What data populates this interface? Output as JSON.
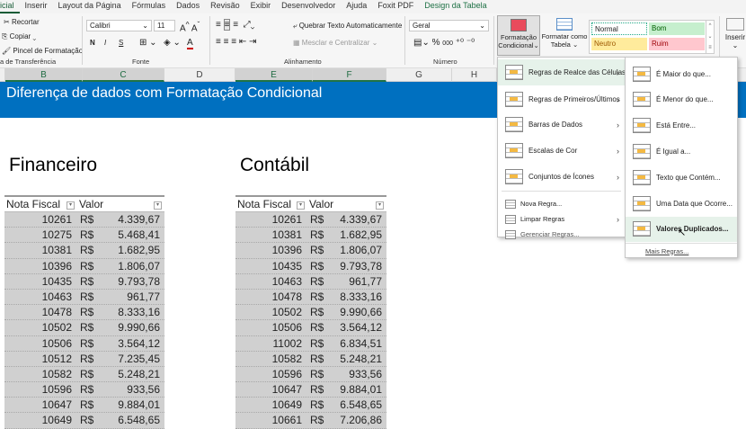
{
  "ribbon_tabs": [
    "icial",
    "Inserir",
    "Layout da Página",
    "Fórmulas",
    "Dados",
    "Revisão",
    "Exibir",
    "Desenvolvedor",
    "Ajuda",
    "Foxit PDF",
    "Design da Tabela"
  ],
  "clipboard": {
    "cut": "Recortar",
    "copy": "Copiar",
    "format_painter": "Pincel de Formatação",
    "group": "a de Transferência"
  },
  "font": {
    "name": "Calibri",
    "size": "11",
    "bold": "N",
    "italic": "I",
    "underline": "S",
    "group": "Fonte"
  },
  "alignment": {
    "wrap": "Quebrar Texto Automaticamente",
    "merge": "Mesclar e Centralizar",
    "group": "Alinhamento"
  },
  "number": {
    "format": "Geral",
    "percent": "%",
    "thousands": "000",
    "group": "Número"
  },
  "styles": {
    "conditional_formatting": [
      "Formatação",
      "Condicional"
    ],
    "format_as_table": [
      "Formatar como",
      "Tabela"
    ],
    "normal": "Normal",
    "good": "Bom",
    "neutral": "Neutro",
    "bad": "Ruim"
  },
  "cells": {
    "insert": "Inserir"
  },
  "columns": [
    "B",
    "C",
    "D",
    "E",
    "F",
    "G",
    "H"
  ],
  "banner": "Diferença de dados com Formatação Condicional",
  "colors": {
    "accent": "#0070c0",
    "excel_green": "#217346",
    "good_bg": "#c6efce",
    "good_fg": "#006100",
    "neutral_bg": "#ffeb9c",
    "neutral_fg": "#9c5700",
    "bad_bg": "#ffc7ce",
    "bad_fg": "#9c0006"
  },
  "tables": [
    {
      "title": "Financeiro",
      "headers": [
        "Nota Fiscal",
        "Valor"
      ],
      "currency": "R$",
      "rows": [
        [
          "10261",
          "4.339,67"
        ],
        [
          "10275",
          "5.468,41"
        ],
        [
          "10381",
          "1.682,95"
        ],
        [
          "10396",
          "1.806,07"
        ],
        [
          "10435",
          "9.793,78"
        ],
        [
          "10463",
          "961,77"
        ],
        [
          "10478",
          "8.333,16"
        ],
        [
          "10502",
          "9.990,66"
        ],
        [
          "10506",
          "3.564,12"
        ],
        [
          "10512",
          "7.235,45"
        ],
        [
          "10582",
          "5.248,21"
        ],
        [
          "10596",
          "933,56"
        ],
        [
          "10647",
          "9.884,01"
        ],
        [
          "10649",
          "6.548,65"
        ]
      ]
    },
    {
      "title": "Contábil",
      "headers": [
        "Nota Fiscal",
        "Valor"
      ],
      "currency": "R$",
      "rows": [
        [
          "10261",
          "4.339,67"
        ],
        [
          "10381",
          "1.682,95"
        ],
        [
          "10396",
          "1.806,07"
        ],
        [
          "10435",
          "9.793,78"
        ],
        [
          "10463",
          "961,77"
        ],
        [
          "10478",
          "8.333,16"
        ],
        [
          "10502",
          "9.990,66"
        ],
        [
          "10506",
          "3.564,12"
        ],
        [
          "11002",
          "6.834,51"
        ],
        [
          "10582",
          "5.248,21"
        ],
        [
          "10596",
          "933,56"
        ],
        [
          "10647",
          "9.884,01"
        ],
        [
          "10649",
          "6.548,65"
        ],
        [
          "10661",
          "7.206,86"
        ]
      ]
    }
  ],
  "menu": {
    "items": [
      "Regras de Realce das Células",
      "Regras de Primeiros/Últimos",
      "Barras de Dados",
      "Escalas de Cor",
      "Conjuntos de Ícones"
    ],
    "small_items": [
      "Nova Regra...",
      "Limpar Regras",
      "Gerenciar Regras..."
    ]
  },
  "submenu": {
    "items": [
      "É Maior do que...",
      "É Menor do que...",
      "Está Entre...",
      "É Igual a...",
      "Texto que Contém...",
      "Uma Data que Ocorre...",
      "Valores Duplicados..."
    ],
    "more": "Mais Regras..."
  }
}
